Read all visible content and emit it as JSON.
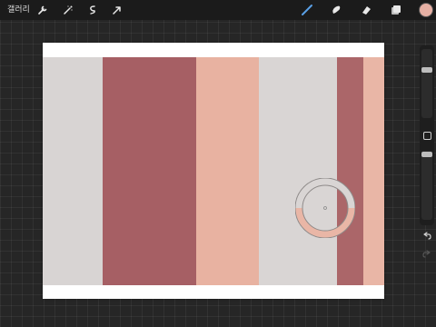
{
  "toolbar": {
    "gallery_label": "갤러리",
    "left_tools": [
      "wrench-icon",
      "magic-wand-icon",
      "selection-icon",
      "transform-arrow-icon"
    ],
    "right_tools": [
      "brush-icon",
      "smudge-icon",
      "eraser-icon",
      "layers-icon"
    ],
    "current_color": "#e6b0a4"
  },
  "artwork": {
    "stripes": [
      {
        "name": "stripe-light-grey-1",
        "color": "#d8d4d3"
      },
      {
        "name": "stripe-dusty-rose-1",
        "color": "#a65f64"
      },
      {
        "name": "stripe-peach-1",
        "color": "#e8b2a1"
      },
      {
        "name": "stripe-light-grey-2",
        "color": "#d9d5d4"
      },
      {
        "name": "stripe-dusty-rose-2",
        "color": "#ab6669"
      },
      {
        "name": "stripe-peach-2",
        "color": "#e9b6a6"
      }
    ]
  },
  "eyedropper": {
    "sampled_color": "#e9b6a6",
    "previous_color": "#d9d5d4"
  },
  "sidebar": {
    "brush_size_level": 0.72,
    "opacity_level": 0.98
  }
}
